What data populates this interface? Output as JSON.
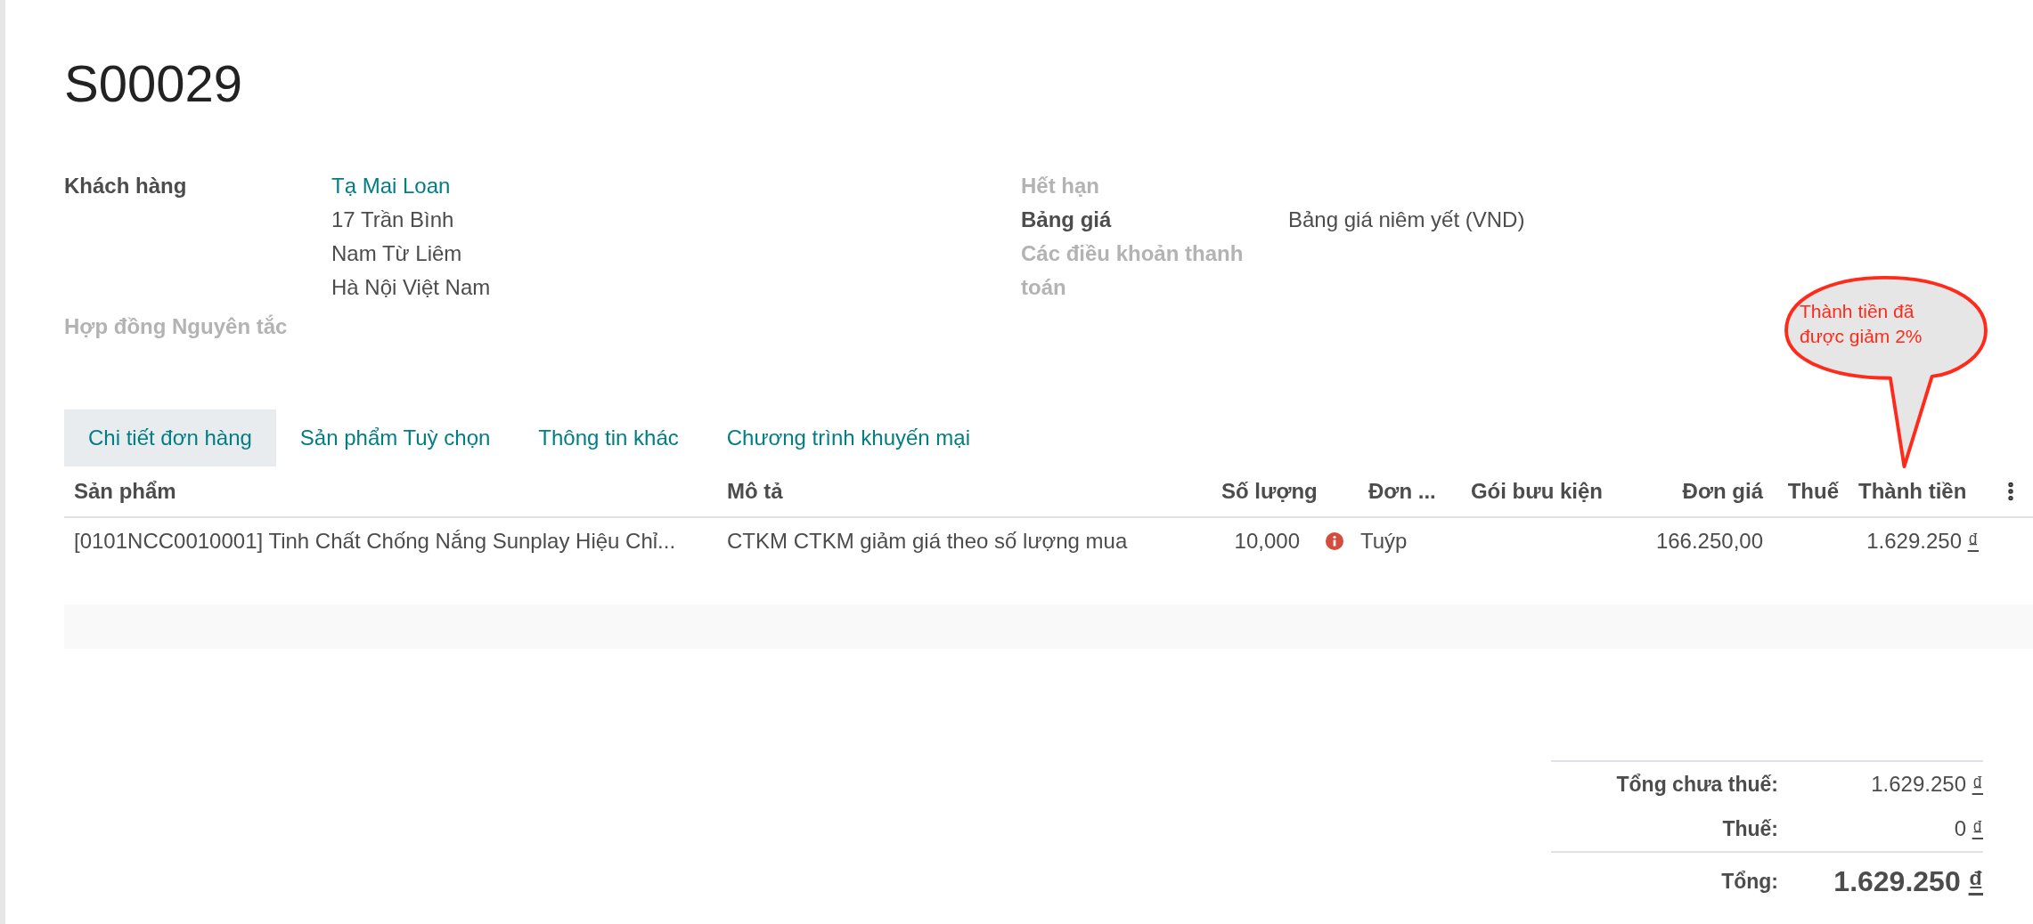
{
  "title": "S00029",
  "left_fields": [
    {
      "label": "Khách hàng",
      "muted": false,
      "link": "Tạ Mai Loan",
      "lines": [
        "17 Trần Bình",
        "Nam Từ Liêm",
        "Hà Nội Việt Nam"
      ]
    },
    {
      "label": "Hợp đồng Nguyên tắc",
      "muted": true
    }
  ],
  "right_fields": [
    {
      "label": "Hết hạn",
      "muted": true
    },
    {
      "label": "Bảng giá",
      "muted": false,
      "lines": [
        "Bảng giá niêm yết (VND)"
      ]
    },
    {
      "label": "Các điều khoản thanh toán",
      "muted": true
    }
  ],
  "tabs": [
    {
      "label": "Chi tiết đơn hàng",
      "selected": true
    },
    {
      "label": "Sản phẩm Tuỳ chọn",
      "selected": false
    },
    {
      "label": "Thông tin khác",
      "selected": false
    },
    {
      "label": "Chương trình khuyến mại",
      "selected": false
    }
  ],
  "columns": [
    "Sản phẩm",
    "Mô tả",
    "Số lượng",
    "Đơn ...",
    "Gói bưu kiện",
    "Đơn giá",
    "Thuế",
    "Thành tiền"
  ],
  "rows": [
    {
      "product": "[0101NCC0010001] Tinh Chất Chống Nắng Sunplay Hiệu Chỉ...",
      "description": "CTKM CTKM giảm giá theo số lượng mua",
      "quantity": "10,000",
      "warning": true,
      "unit": "Tuýp",
      "price": "166.250,00",
      "subtotal": "1.629.250",
      "currency": "₫"
    }
  ],
  "totals": [
    {
      "kind": "normal",
      "label": "Tổng chưa thuế:",
      "amount": "1.629.250",
      "currency": "₫"
    },
    {
      "kind": "normal",
      "label": "Thuế:",
      "amount": "0",
      "currency": "₫"
    },
    {
      "kind": "grand",
      "label": "Tổng:",
      "amount": "1.629.250",
      "currency": "₫"
    }
  ],
  "callout": {
    "lines": [
      "Thành tiền đã",
      "được giảm 2%"
    ]
  }
}
